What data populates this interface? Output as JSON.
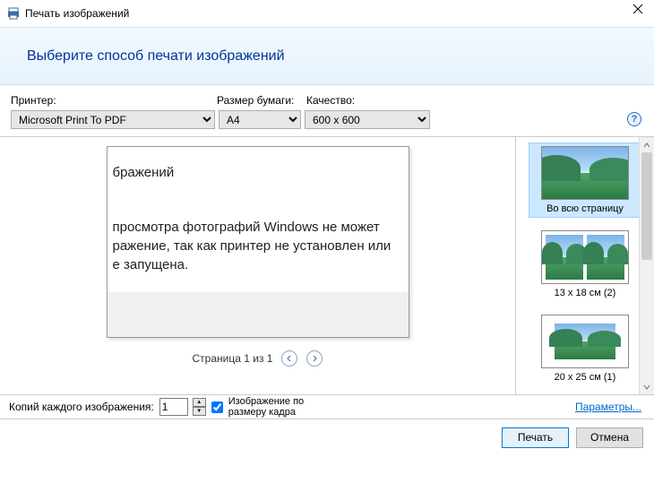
{
  "window": {
    "title": "Печать изображений",
    "headline": "Выберите способ печати изображений"
  },
  "selectors": {
    "printer_label": "Принтер:",
    "paper_label": "Размер бумаги:",
    "quality_label": "Качество:",
    "printer_value": "Microsoft Print To PDF",
    "paper_value": "A4",
    "quality_value": "600 x 600"
  },
  "preview": {
    "doc_header": "бражений",
    "doc_line1": "просмотра фотографий Windows не может",
    "doc_line2": "ражение, так как принтер не установлен или",
    "doc_line3": "е запущена.",
    "pager": "Страница 1 из 1"
  },
  "layouts": [
    {
      "label": "Во всю страницу",
      "kind": "full",
      "selected": true
    },
    {
      "label": "13 x 18 см (2)",
      "kind": "two",
      "selected": false
    },
    {
      "label": "20 x 25 см (1)",
      "kind": "one",
      "selected": false
    }
  ],
  "bottom": {
    "copies_label": "Копий каждого изображения:",
    "copies_value": "1",
    "fit_checked": true,
    "fit_label": "Изображение по размеру кадра",
    "params_link": "Параметры..."
  },
  "actions": {
    "print": "Печать",
    "cancel": "Отмена"
  }
}
